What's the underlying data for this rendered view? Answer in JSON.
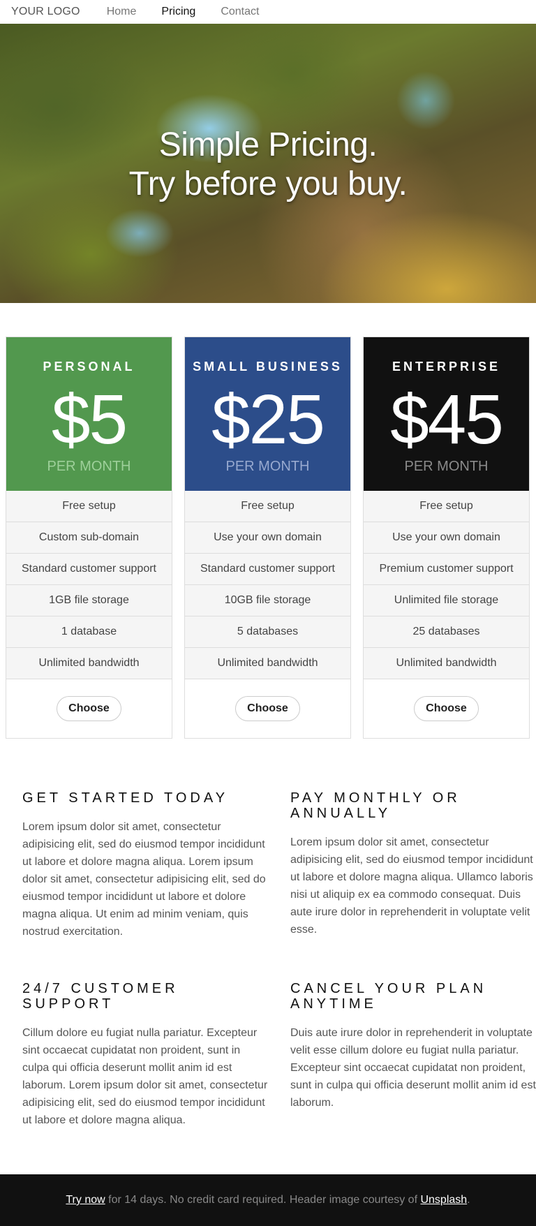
{
  "header": {
    "logo": "YOUR LOGO",
    "nav": [
      {
        "label": "Home",
        "active": false
      },
      {
        "label": "Pricing",
        "active": true
      },
      {
        "label": "Contact",
        "active": false
      }
    ]
  },
  "banner": {
    "line1": "Simple Pricing.",
    "line2": "Try before you buy."
  },
  "plans": [
    {
      "name": "PERSONAL",
      "price": "$5",
      "period": "PER MONTH",
      "color": "#52984e",
      "period_color": "#9ed09a",
      "features": [
        "Free setup",
        "Custom sub-domain",
        "Standard customer support",
        "1GB file storage",
        "1 database",
        "Unlimited bandwidth"
      ],
      "button": "Choose"
    },
    {
      "name": "SMALL BUSINESS",
      "price": "$25",
      "period": "PER MONTH",
      "color": "#2c4d8a",
      "period_color": "#97a9cf",
      "features": [
        "Free setup",
        "Use your own domain",
        "Standard customer support",
        "10GB file storage",
        "5 databases",
        "Unlimited bandwidth"
      ],
      "button": "Choose"
    },
    {
      "name": "ENTERPRISE",
      "price": "$45",
      "period": "PER MONTH",
      "color": "#111111",
      "period_color": "#8a8a8a",
      "features": [
        "Free setup",
        "Use your own domain",
        "Premium customer support",
        "Unlimited file storage",
        "25 databases",
        "Unlimited bandwidth"
      ],
      "button": "Choose"
    }
  ],
  "info": [
    {
      "heading": "Get Started Today",
      "text": "Lorem ipsum dolor sit amet, consectetur adipisicing elit, sed do eiusmod tempor incididunt ut labore et dolore magna aliqua. Lorem ipsum dolor sit amet, consectetur adipisicing elit, sed do eiusmod tempor incididunt ut labore et dolore magna aliqua. Ut enim ad minim veniam, quis nostrud exercitation."
    },
    {
      "heading": "Pay monthly or annually",
      "text": "Lorem ipsum dolor sit amet, consectetur adipisicing elit, sed do eiusmod tempor incididunt ut labore et dolore magna aliqua. Ullamco laboris nisi ut aliquip ex ea commodo consequat. Duis aute irure dolor in reprehenderit in voluptate velit esse."
    },
    {
      "heading": "24/7 customer support",
      "text": "Cillum dolore eu fugiat nulla pariatur. Excepteur sint occaecat cupidatat non proident, sunt in culpa qui officia deserunt mollit anim id est laborum. Lorem ipsum dolor sit amet, consectetur adipisicing elit, sed do eiusmod tempor incididunt ut labore et dolore magna aliqua."
    },
    {
      "heading": "Cancel your plan anytime",
      "text": "Duis aute irure dolor in reprehenderit in voluptate velit esse cillum dolore eu fugiat nulla pariatur. Excepteur sint occaecat cupidatat non proident, sunt in culpa qui officia deserunt mollit anim id est laborum."
    }
  ],
  "footer": {
    "try_link": "Try now",
    "middle": " for 14 days. No credit card required. Header image courtesy of ",
    "credit_link": "Unsplash",
    "end": "."
  }
}
